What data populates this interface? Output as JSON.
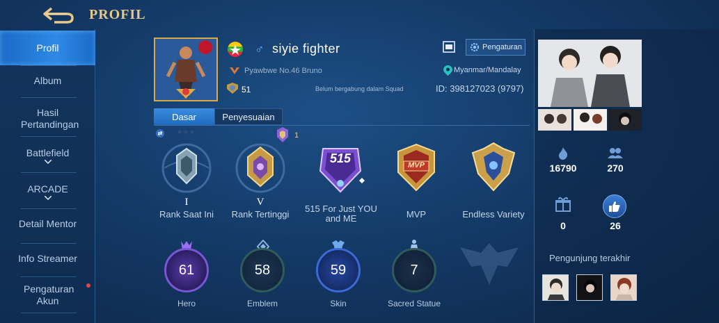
{
  "header": {
    "title": "PROFIL"
  },
  "sidebar": {
    "items": [
      {
        "label": "Profil",
        "active": true
      },
      {
        "label": "Album"
      },
      {
        "label": "Hasil Pertandingan"
      },
      {
        "label": "Battlefield"
      },
      {
        "label": "ARCADE"
      },
      {
        "label": "Detail Mentor"
      },
      {
        "label": "Info Streamer"
      },
      {
        "label": "Pengaturan Akun"
      }
    ]
  },
  "profile": {
    "name": "siyie fighter",
    "gender_symbol": "♂",
    "title": "Pyawbwe No.46 Bruno",
    "badge_count": "51",
    "squad": "Belum bergabung dalam Squad",
    "location": "Myanmar/Mandalay",
    "id": "ID: 398127023 (9797)",
    "settings_label": "Pengaturan"
  },
  "tabs": {
    "basic": "Dasar",
    "custom": "Penyesuaian"
  },
  "ranks": {
    "current_label": "Rank Saat Ini",
    "current_roman": "I",
    "highest_label": "Rank Tertinggi",
    "highest_roman": "V",
    "highest_badge": "1",
    "achievement_number": "515",
    "achievement_label": "515 For Just YOU and ME",
    "mvp_label": "MVP",
    "mvp_text": "MVP",
    "variety_label": "Endless Variety"
  },
  "stats": [
    {
      "value": "61",
      "label": "Hero"
    },
    {
      "value": "58",
      "label": "Emblem"
    },
    {
      "value": "59",
      "label": "Skin"
    },
    {
      "value": "7",
      "label": "Sacred Statue"
    }
  ],
  "right": {
    "popularity": "16790",
    "followers": "270",
    "gifts": "0",
    "likes": "26",
    "recent_visitors_label": "Pengunjung terakhir"
  },
  "colors": {
    "gold": "#e8c889",
    "accent": "#2e8ae6",
    "background": "#143a67"
  }
}
